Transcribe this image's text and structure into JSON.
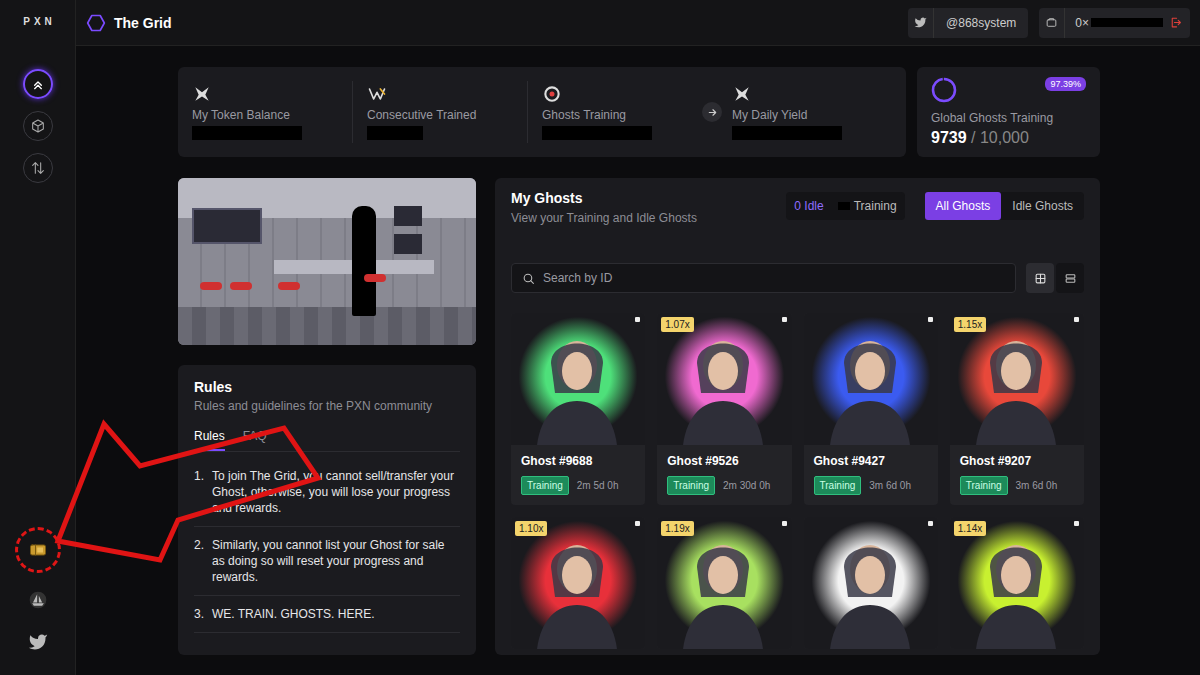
{
  "sidebar": {
    "logo": "PXN",
    "items": [
      {
        "selected": true
      },
      {
        "selected": false
      },
      {
        "selected": false
      }
    ],
    "bottom_items": [
      {
        "circled": true
      },
      {
        "circled": false
      },
      {
        "circled": false
      }
    ]
  },
  "topbar": {
    "title": "The Grid",
    "twitter": "@868system",
    "wallet": "0×",
    "wallet_redacted": true
  },
  "stats": [
    {
      "label": "My Token Balance",
      "redacted": true
    },
    {
      "label": "Consecutive Trained",
      "redacted": true
    },
    {
      "label": "Ghosts Training",
      "redacted": true
    },
    {
      "label": "My Daily Yield",
      "redacted": true
    }
  ],
  "global": {
    "label": "Global Ghosts Training",
    "percent": "97.39%",
    "count": "9739",
    "total": "/ 10,000",
    "level": 0.9739
  },
  "rules": {
    "title": "Rules",
    "subtitle": "Rules and guidelines for the PXN community",
    "tabs": [
      {
        "label": "Rules",
        "selected": true
      },
      {
        "label": "FAQ",
        "selected": false
      }
    ],
    "items": [
      {
        "num": "1.",
        "text": "To join The Grid, you cannot sell/transfer your Ghost, otherwise, you will lose your progress and rewards."
      },
      {
        "num": "2.",
        "text": "Similarly, you cannot list your Ghost for sale as doing so will reset your progress and rewards."
      },
      {
        "num": "3.",
        "text": "WE. TRAIN. GHOSTS. HERE."
      }
    ]
  },
  "ghosts": {
    "title": "My Ghosts",
    "subtitle": "View your Training and Idle Ghosts",
    "counters": [
      {
        "label": "0 Idle",
        "redacted": false
      },
      {
        "label": "Training",
        "redacted": true
      }
    ],
    "segments": [
      {
        "label": "All Ghosts",
        "selected": true
      },
      {
        "label": "Idle Ghosts",
        "selected": false
      }
    ],
    "views": [
      {
        "selected": true
      },
      {
        "selected": false
      }
    ],
    "search": {
      "placeholder": "Search by ID"
    },
    "items": [
      {
        "name": "Ghost #9688",
        "status": "Training",
        "time": "2m 5d 0h",
        "color": "#4ee07a"
      },
      {
        "name": "Ghost #9526",
        "multiplier": "1.07x",
        "status": "Training",
        "time": "2m 30d 0h",
        "color": "#f06ad0"
      },
      {
        "name": "Ghost #9427",
        "status": "Training",
        "time": "3m 6d 0h",
        "color": "#3b5bf0"
      },
      {
        "name": "Ghost #9207",
        "multiplier": "1.15x",
        "status": "Training",
        "time": "3m 6d 0h",
        "color": "#e8483a"
      },
      {
        "multiplier": "1.10x",
        "color": "#e8303a"
      },
      {
        "multiplier": "1.19x",
        "color": "#a8e060"
      },
      {
        "color": "#f2f2f2"
      },
      {
        "multiplier": "1.14x",
        "color": "#c8f030"
      }
    ]
  }
}
